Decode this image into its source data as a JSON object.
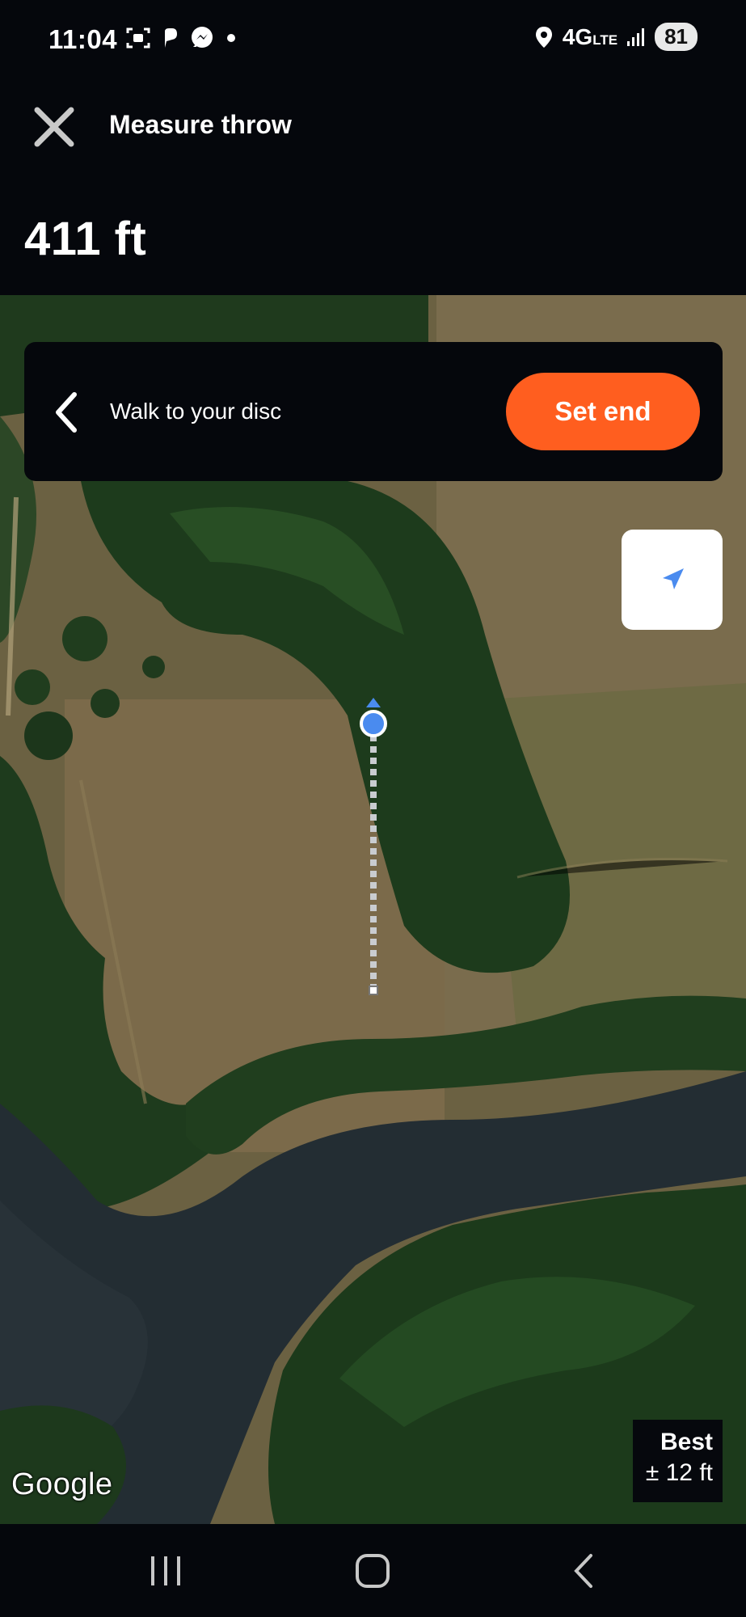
{
  "status_bar": {
    "time": "11:04",
    "network": "4G",
    "network_sub": "LTE",
    "battery": "81",
    "left_icons": [
      "screen-record-icon",
      "navigation-app-icon",
      "messenger-icon",
      "dot-icon"
    ],
    "right_icons": [
      "location-pin-icon",
      "signal-icon"
    ]
  },
  "header": {
    "close_icon": "close-icon",
    "title": "Measure throw",
    "distance": "411 ft"
  },
  "walk_panel": {
    "back_icon": "chevron-left-icon",
    "message": "Walk to your disc",
    "set_end_label": "Set end"
  },
  "map": {
    "locate_icon": "navigation-arrow-icon",
    "accuracy_label": "Best",
    "accuracy_value": "± 12 ft",
    "attribution": "Google"
  },
  "colors": {
    "accent": "#ff5e1f",
    "location_dot": "#4a8bef",
    "background": "#05070c"
  },
  "nav_bar": {
    "icons": [
      "recent-apps-icon",
      "home-icon",
      "back-icon"
    ]
  }
}
